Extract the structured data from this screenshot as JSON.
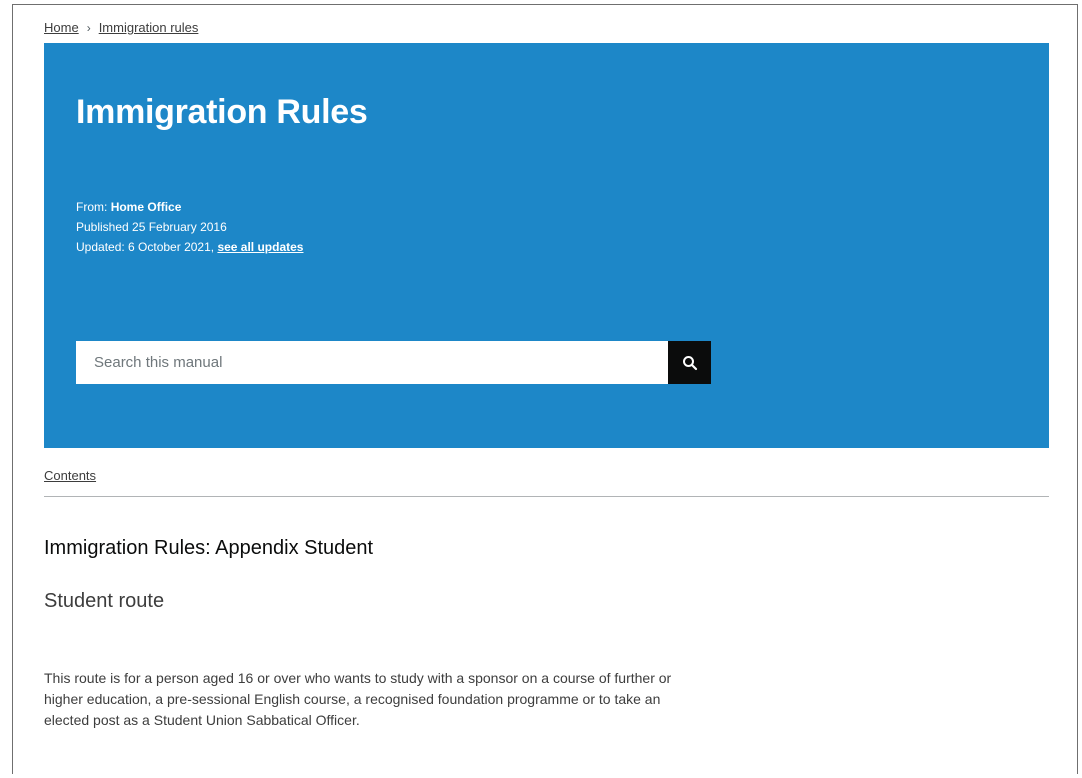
{
  "breadcrumb": {
    "home": "Home",
    "separator": "›",
    "current": "Immigration rules"
  },
  "banner": {
    "background_color": "#1d87c8",
    "title": "Immigration Rules",
    "from_label": "From:",
    "from_value": "Home Office",
    "published": "Published 25 February 2016",
    "updated_prefix": "Updated: 6 October 2021,",
    "updates_link": "see all updates"
  },
  "search": {
    "placeholder": "Search this manual",
    "button_icon": "search-icon"
  },
  "contents_link": "Contents",
  "heading": "Immigration Rules: Appendix Student",
  "subheading": "Student route",
  "body": "This route is for a person aged 16 or over who wants to study with a sponsor on a course of further or higher education, a pre-sessional English course, a recognised foundation programme or to take an elected post as a Student Union Sabbatical Officer."
}
